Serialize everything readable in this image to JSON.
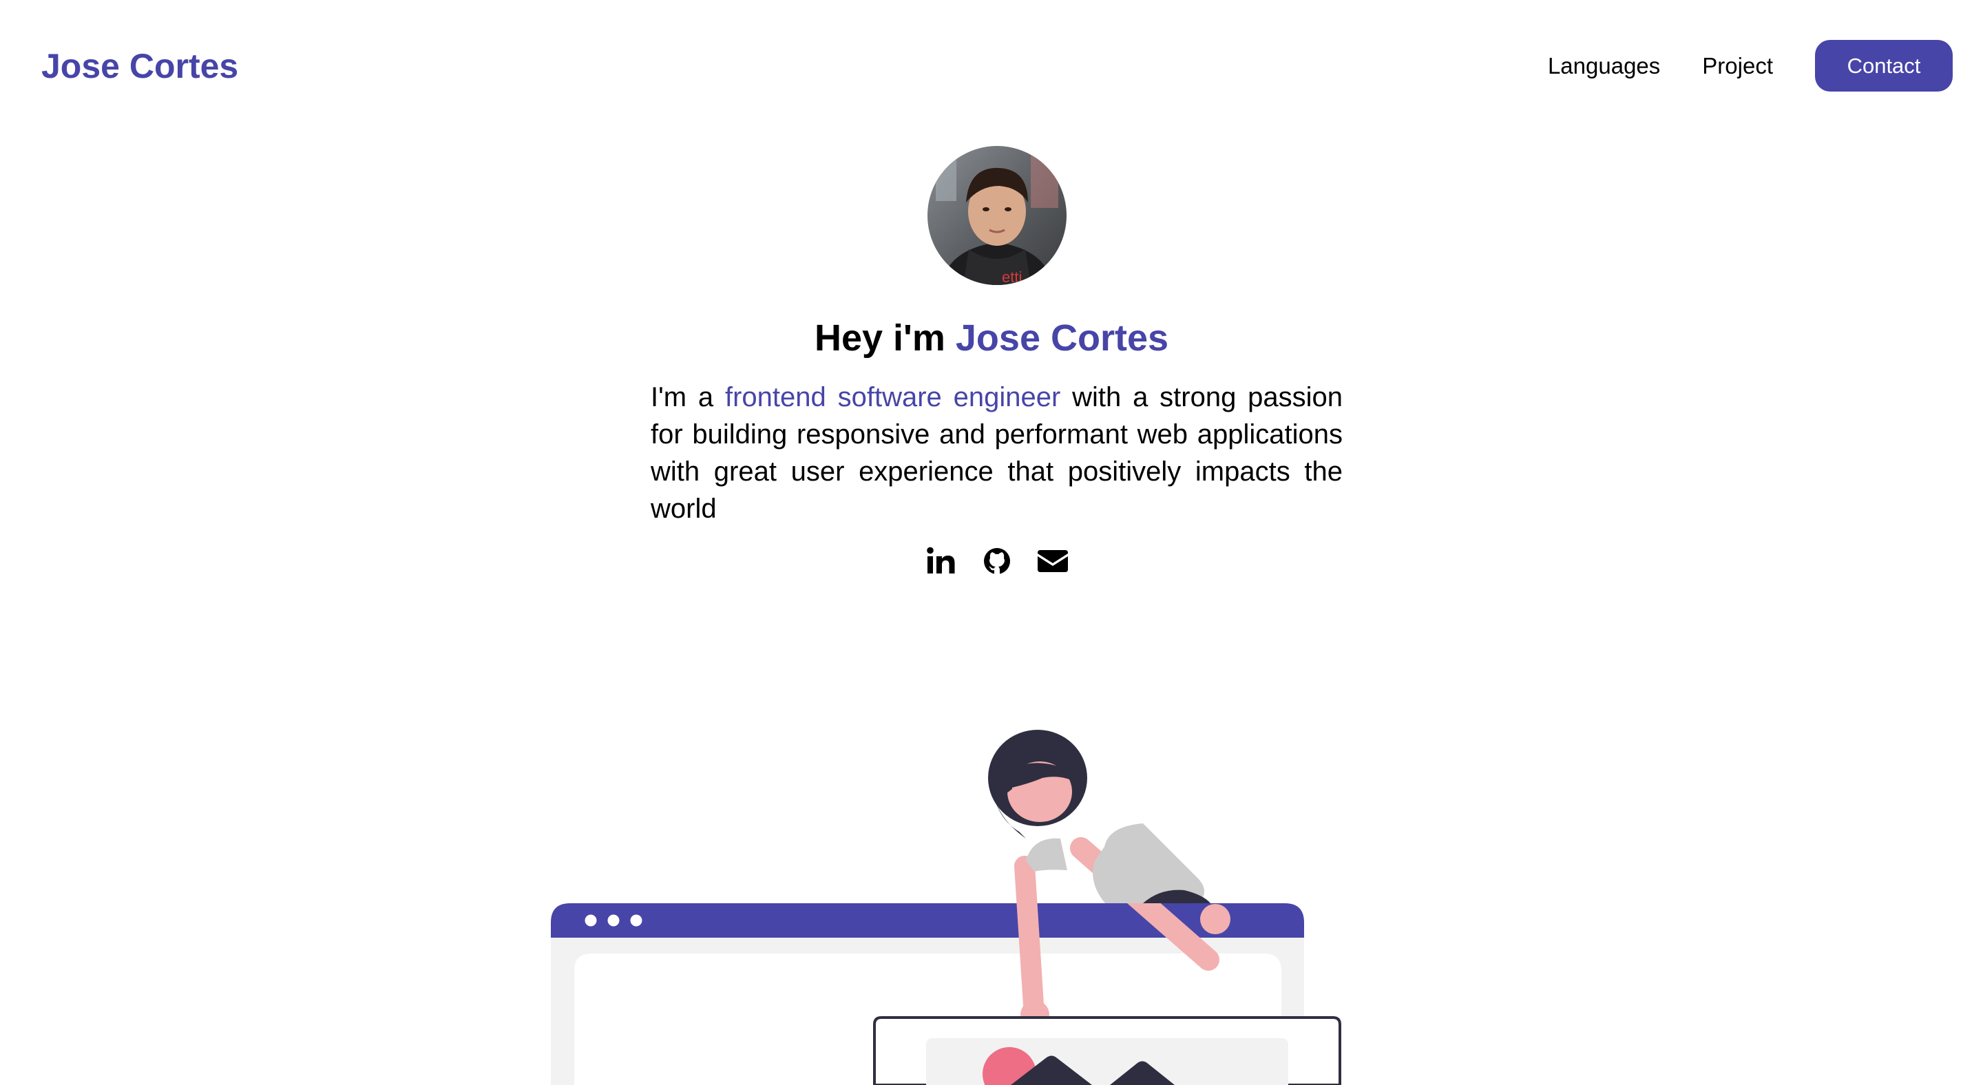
{
  "header": {
    "brand": "Jose Cortes",
    "nav": {
      "languages": "Languages",
      "project": "Project",
      "contact": "Contact"
    }
  },
  "hero": {
    "greeting_prefix": "Hey i'm ",
    "greeting_name": "Jose Cortes",
    "bio_prefix": "I'm a ",
    "bio_highlight": "frontend software engineer",
    "bio_suffix": " with a strong passion for building responsive and performant web applications with great user experience that positively impacts the world"
  },
  "socials": [
    {
      "icon": "linkedin-icon"
    },
    {
      "icon": "github-icon"
    },
    {
      "icon": "mail-icon"
    }
  ],
  "colors": {
    "accent": "#4745a8",
    "text": "#000000",
    "background": "#ffffff",
    "illustration_dark": "#2f2e41",
    "illustration_skin": "#f2b0b0",
    "illustration_shirt": "#cccccc",
    "illustration_pink": "#ee6e85",
    "illustration_panel": "#f2f2f2"
  }
}
